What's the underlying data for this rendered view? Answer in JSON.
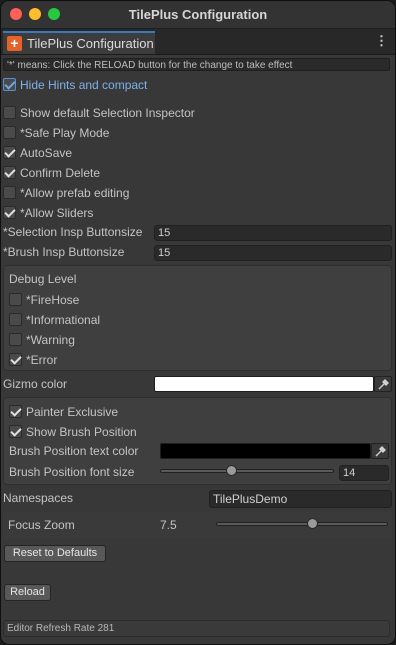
{
  "window": {
    "title": "TilePlus Configuration"
  },
  "tab": {
    "label": "TilePlus Configuration",
    "icon": "tileplus-icon"
  },
  "notice": "'*' means: Click the RELOAD button for the change to take effect",
  "options": {
    "hide_hints": {
      "label": "Hide Hints and compact",
      "checked": true
    },
    "show_default_selection_inspector": {
      "label": "Show default Selection Inspector",
      "checked": false
    },
    "safe_play_mode": {
      "label": "*Safe Play Mode",
      "checked": false
    },
    "autosave": {
      "label": "AutoSave",
      "checked": true
    },
    "confirm_delete": {
      "label": "Confirm Delete",
      "checked": true
    },
    "allow_prefab_editing": {
      "label": "*Allow prefab editing",
      "checked": false
    },
    "allow_sliders": {
      "label": "*Allow Sliders",
      "checked": true
    }
  },
  "selection_insp_buttonsize": {
    "label": "*Selection Insp Buttonsize",
    "value": "15"
  },
  "brush_insp_buttonsize": {
    "label": "*Brush Insp Buttonsize",
    "value": "15"
  },
  "debug": {
    "title": "Debug Level",
    "items": [
      {
        "label": "*FireHose",
        "checked": false
      },
      {
        "label": "*Informational",
        "checked": false
      },
      {
        "label": "*Warning",
        "checked": false
      },
      {
        "label": "*Error",
        "checked": true
      }
    ]
  },
  "gizmo_color": {
    "label": "Gizmo color",
    "color": "#ffffff"
  },
  "painter": {
    "painter_exclusive": {
      "label": "Painter Exclusive",
      "checked": true
    },
    "show_brush_position": {
      "label": "Show Brush Position",
      "checked": true
    },
    "brush_position_text_color": {
      "label": "Brush Position text color",
      "color": "#000000"
    },
    "brush_position_font_size": {
      "label": "Brush Position font size",
      "value": "14",
      "fraction": 0.41
    }
  },
  "namespaces": {
    "label": "Namespaces",
    "value": "TilePlusDemo"
  },
  "focus_zoom": {
    "label": "Focus Zoom",
    "value": "7.5",
    "fraction": 0.56
  },
  "buttons": {
    "reset": "Reset to Defaults",
    "reload": "Reload"
  },
  "status": "Editor Refresh Rate 281"
}
